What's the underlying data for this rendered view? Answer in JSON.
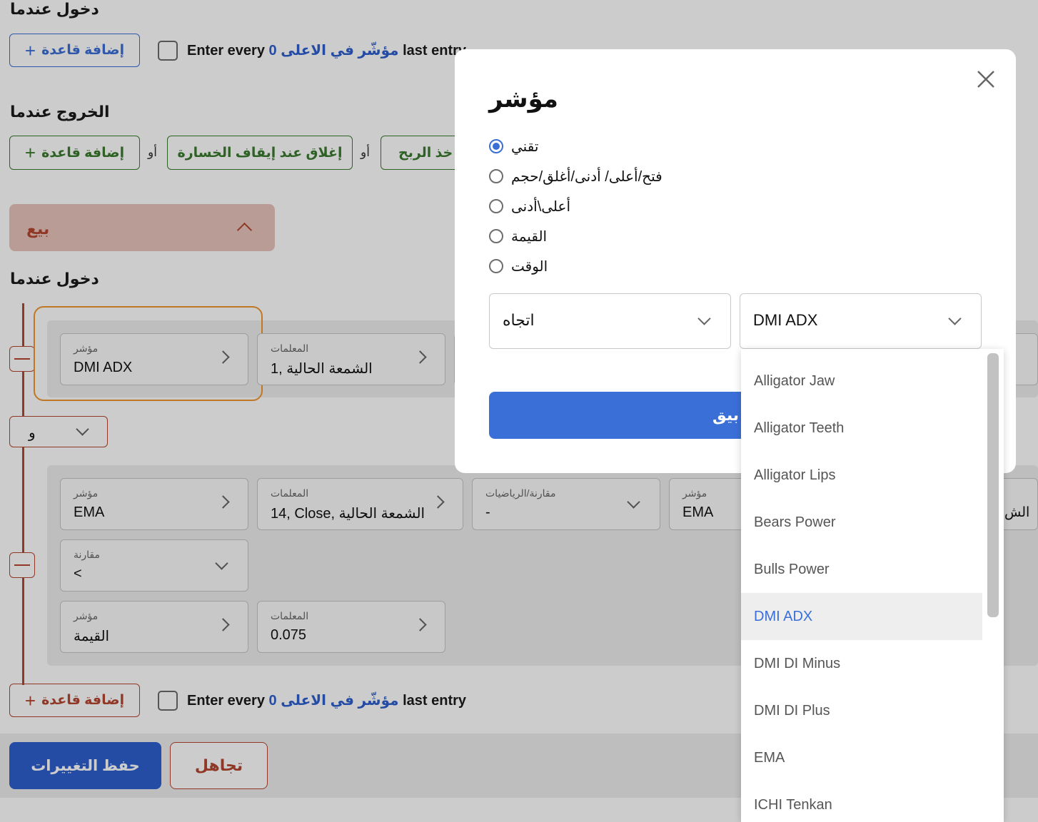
{
  "buy": {
    "entry_title": "دخول عندما",
    "add_rule": "إضافة قاعدة",
    "entry_rule_parts": [
      "Enter every",
      "0",
      "مؤشّر في الاعلى",
      "last entry"
    ],
    "exit_title": "الخروج عندما",
    "or_label": "أو",
    "stop_loss_button": "إغلاق عند إيقاف الخسارة",
    "take_profit_button": "خذ الربح"
  },
  "sell": {
    "header": "بيع",
    "entry_title": "دخول عندما",
    "condition1": {
      "indicator_label": "مؤشر",
      "indicator_value": "DMI ADX",
      "params_label": "المعلمات",
      "params_value": "1, الشمعة الحالية"
    },
    "logic_operator": "و",
    "condition2": {
      "indicator_label": "مؤشر",
      "indicator_value": "EMA",
      "params_label": "المعلمات",
      "params_value": "14, Close, الشمعة الحالية",
      "math_label": "مقارنة/الرياضيات",
      "math_value": "-",
      "indicator2_label": "مؤشر",
      "indicator2_value": "EMA",
      "clipped_text": "الش",
      "compare_label": "مقارنة",
      "compare_value": "<",
      "indicator3_label": "مؤشر",
      "indicator3_value": "القيمة",
      "params3_label": "المعلمات",
      "params3_value": "0.075"
    },
    "add_rule": "إضافة قاعدة",
    "entry_rule_parts": [
      "Enter every",
      "0",
      "مؤشّر في الاعلى",
      "last entry"
    ]
  },
  "footer": {
    "save": "حفظ التغييرات",
    "ignore": "تجاهل"
  },
  "modal": {
    "title": "مؤشر",
    "radio_options": [
      "تقني",
      "فتح/أعلى/ أدنى/أغلق/حجم",
      "أعلى\\أدنى",
      "القيمة",
      "الوقت"
    ],
    "selected_radio": "تقني",
    "direction_select": "اتجاه",
    "indicator_select": "DMI ADX",
    "apply_partial": "بيق",
    "dropdown_items": [
      "Alligator Jaw",
      "Alligator Teeth",
      "Alligator Lips",
      "Bears Power",
      "Bulls Power",
      "DMI ADX",
      "DMI DI Minus",
      "DMI DI Plus",
      "EMA",
      "ICHI Tenkan"
    ],
    "selected_item": "DMI ADX"
  },
  "colors": {
    "accent_blue": "#3b6fd8",
    "accent_green": "#3a7a2e",
    "accent_red": "#b5472f",
    "highlight_orange": "#f0962e"
  }
}
